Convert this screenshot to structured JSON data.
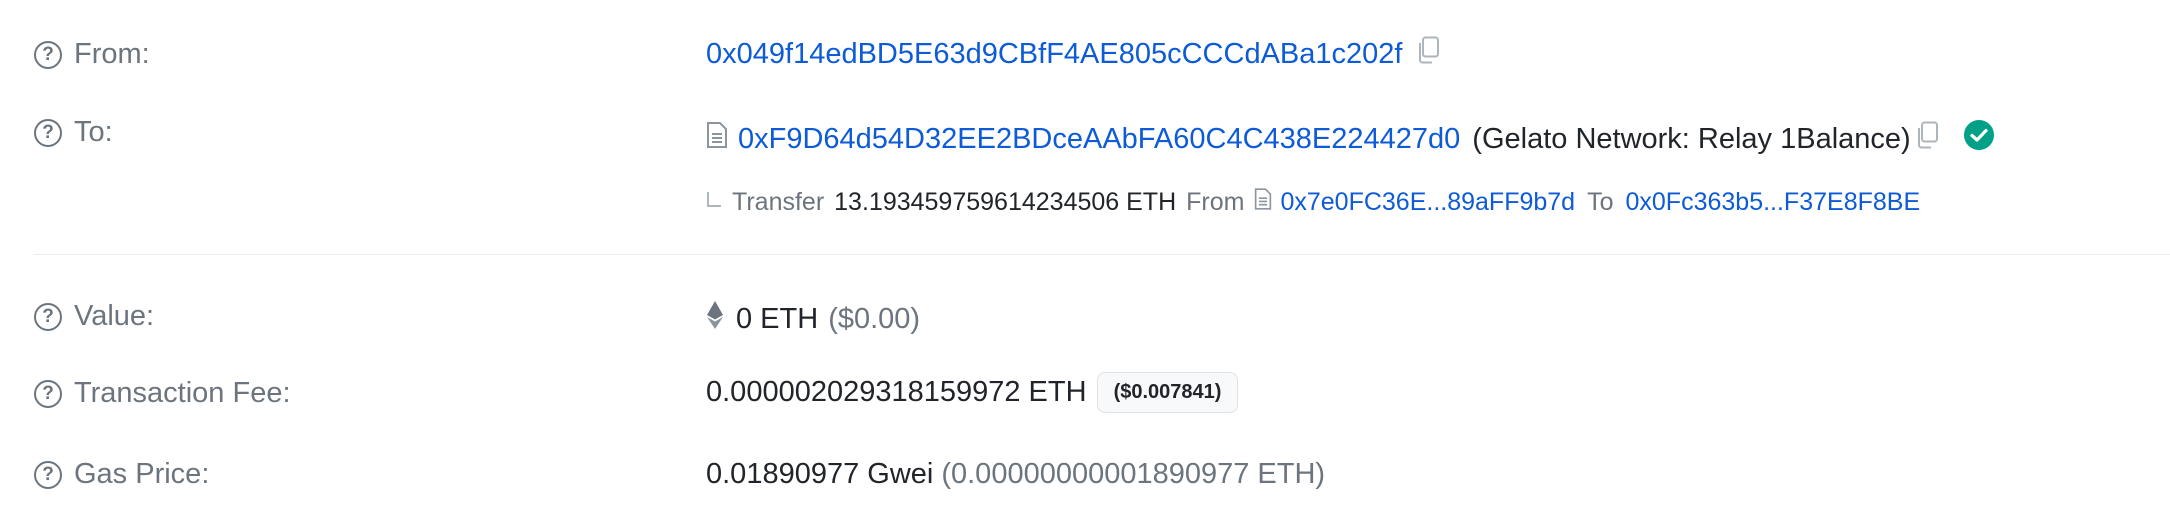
{
  "from": {
    "label": "From:",
    "address": "0x049f14edBD5E63d9CBfF4AE805cCCCdABa1c202f"
  },
  "to": {
    "label": "To:",
    "address": "0xF9D64d54D32EE2BDceAAbFA60C4C438E224427d0",
    "name": "(Gelato Network: Relay 1Balance)",
    "transfer": {
      "prefix": "Transfer",
      "amount": "13.193459759614234506 ETH",
      "from_label": "From",
      "from_address": "0x7e0FC36E...89aFF9b7d",
      "to_label": "To",
      "to_address": "0x0Fc363b5...F37E8F8BE"
    }
  },
  "value": {
    "label": "Value:",
    "amount": "0 ETH",
    "usd": "($0.00)"
  },
  "fee": {
    "label": "Transaction Fee:",
    "amount": "0.000002029318159972 ETH",
    "usd": "($0.007841)"
  },
  "gas": {
    "label": "Gas Price:",
    "amount": "0.01890977 Gwei",
    "eth": "(0.00000000001890977 ETH)"
  },
  "icons": {
    "help": "question-circle-icon",
    "copy": "copy-icon",
    "contract": "document-icon",
    "verified": "check-circle-icon",
    "eth": "ethereum-icon"
  },
  "colors": {
    "link": "#0d5bd7",
    "verified": "#00a186",
    "label": "#6c757d"
  }
}
